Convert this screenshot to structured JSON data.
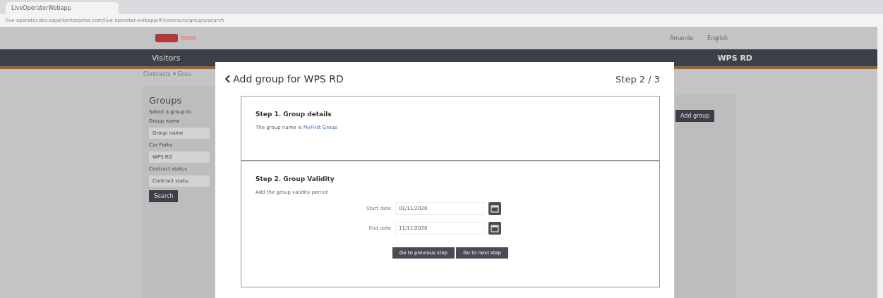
{
  "browser": {
    "tab_title": "LiveOperatorWebapp",
    "url": "live-operator.dev.ssparkenterprise.com/live-operator-webapp/#/contracts/groups/search"
  },
  "header": {
    "user": "Amanda",
    "language": "English"
  },
  "nav": {
    "items": [
      "Visitors"
    ],
    "car_park": "WPS RD"
  },
  "breadcrumb": [
    "Contracts",
    "Grou"
  ],
  "sidebar": {
    "title": "Groups",
    "subtitle": "Select a group to",
    "fields": [
      {
        "label": "Group name",
        "placeholder": "Group name"
      },
      {
        "label": "Car Parks",
        "value": "WPS RD"
      },
      {
        "label": "Contract status",
        "placeholder": "Contract statu"
      }
    ],
    "button": "Search"
  },
  "results": {
    "button": "Add group"
  },
  "modal": {
    "title": "Add group for WPS RD",
    "step": "Step 2 / 3",
    "sections": [
      {
        "title": "Step 1. Group details",
        "text": "The group name is ",
        "link": "MyFirst Group"
      },
      {
        "title": "Step 2. Group Validity",
        "text": "Add the group validity period",
        "dates": [
          {
            "label": "Start date",
            "value": "01/11/2020"
          },
          {
            "label": "End date",
            "value": "11/11/2020"
          }
        ]
      }
    ],
    "buttons": [
      "Go to previous step",
      "Go to next step"
    ]
  }
}
